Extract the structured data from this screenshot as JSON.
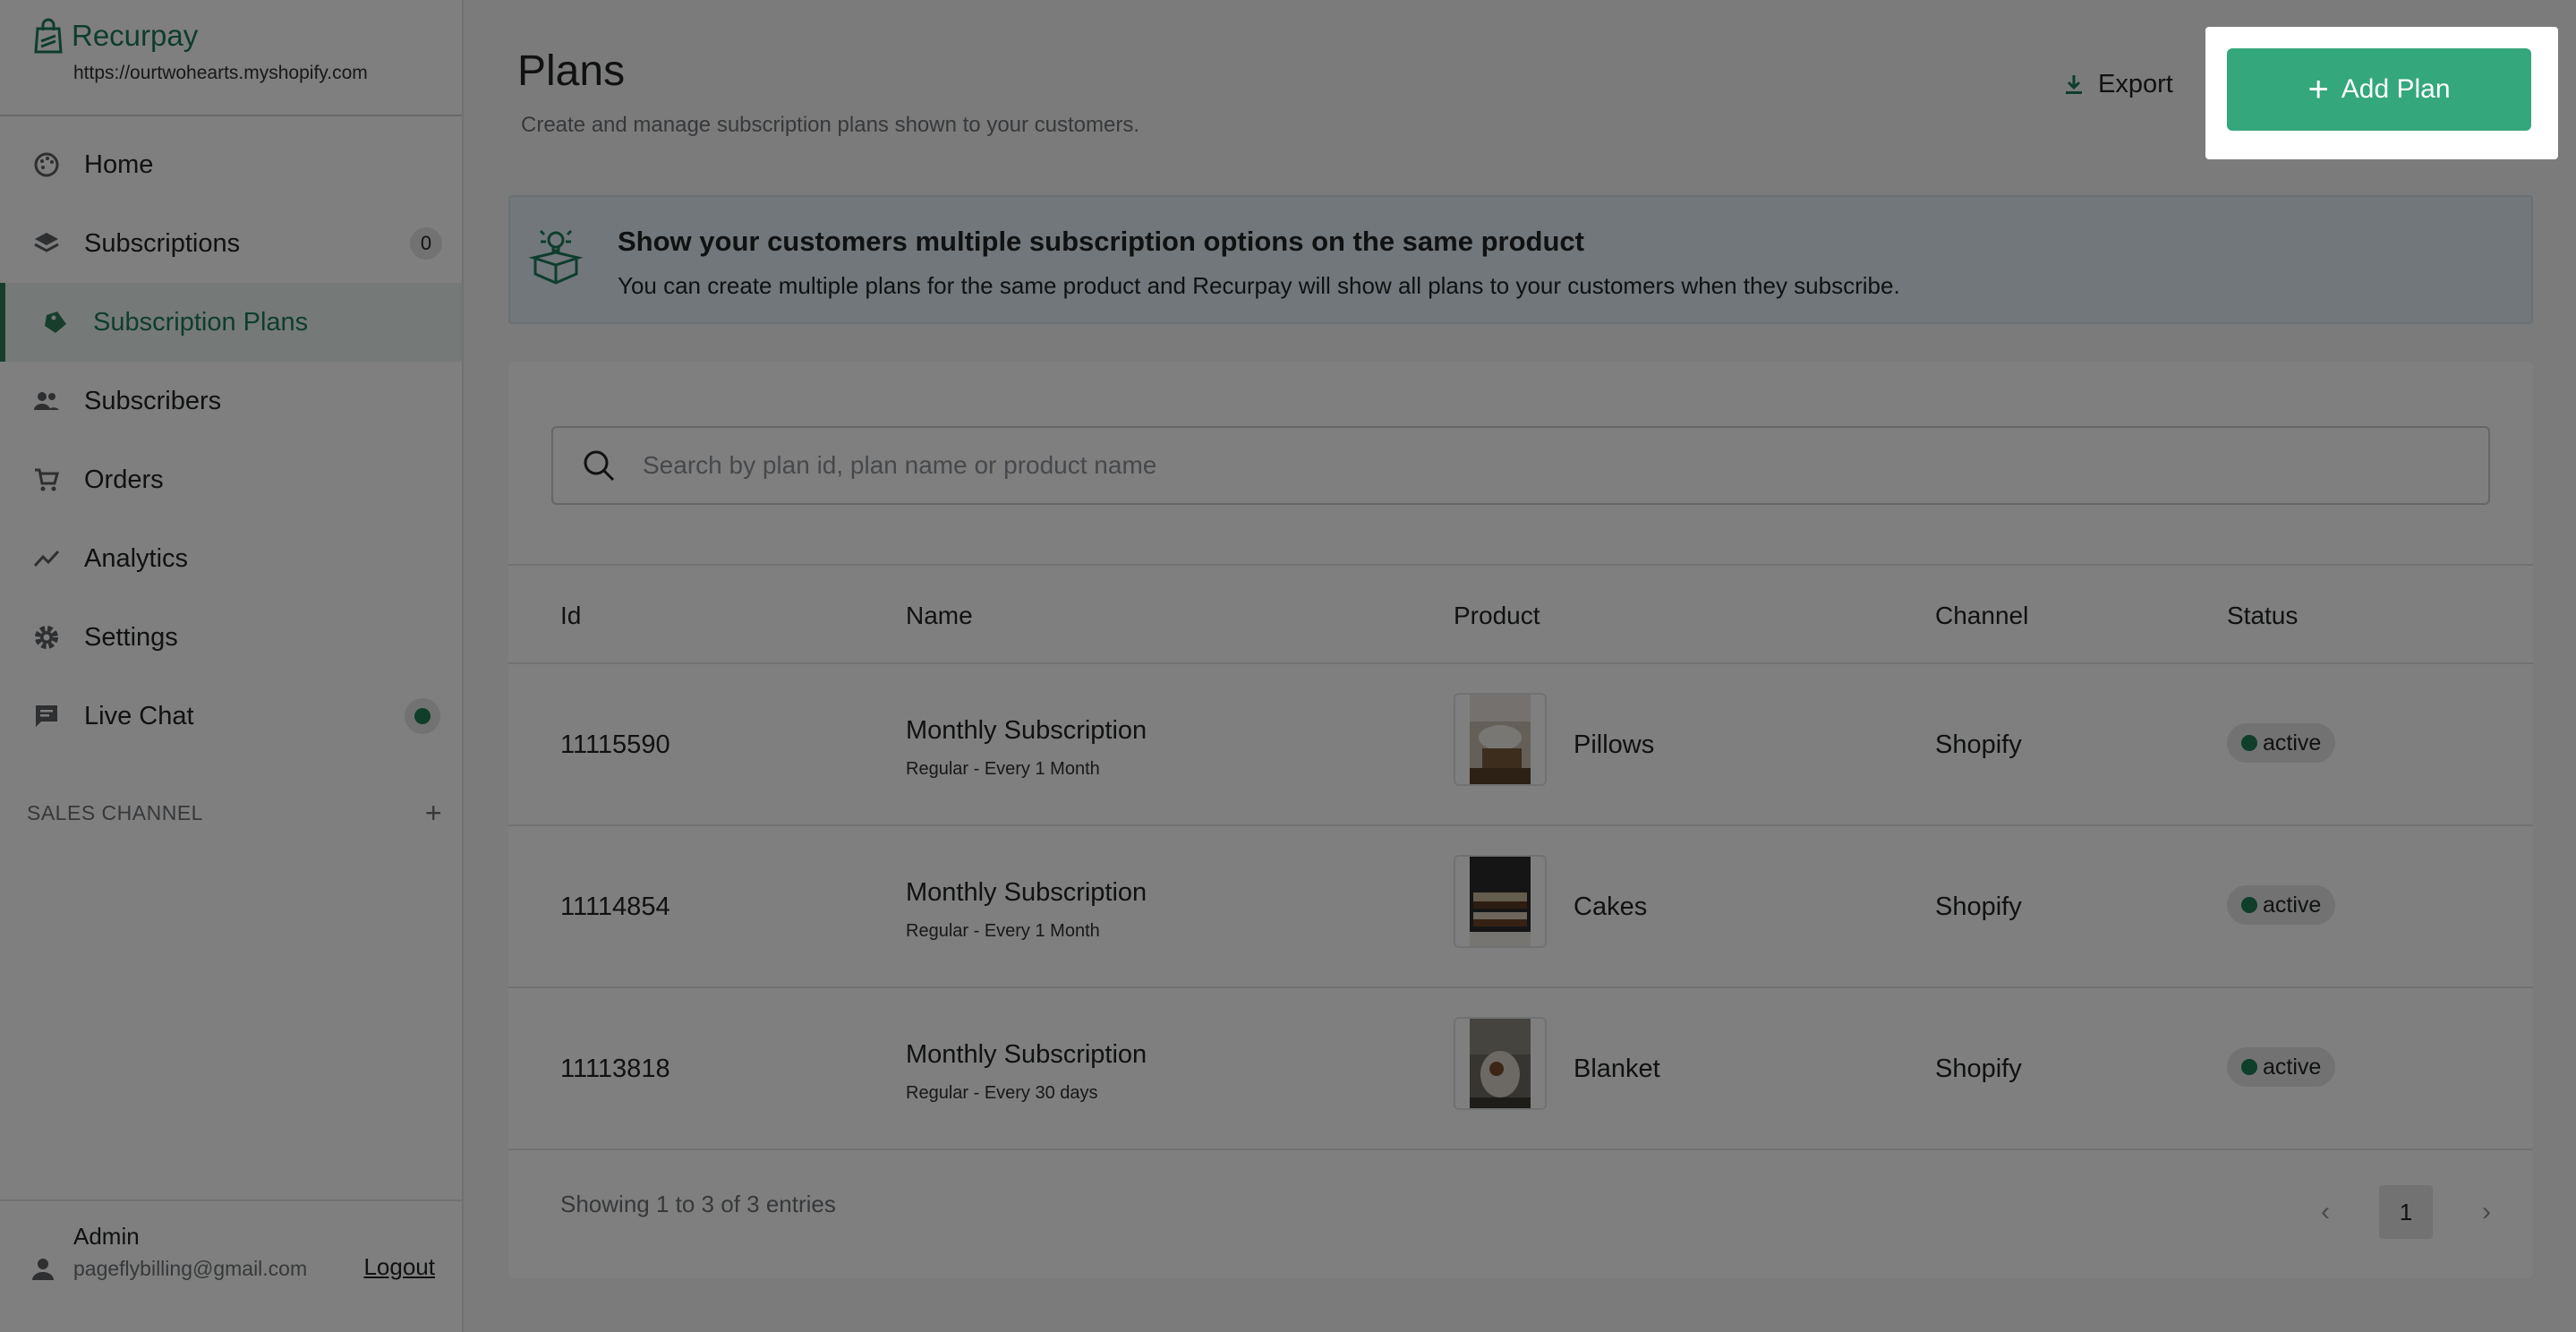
{
  "brand": {
    "name": "Recurpay",
    "store_url": "https://ourtwohearts.myshopify.com"
  },
  "sidebar": {
    "items": [
      {
        "label": "Home",
        "icon": "palette-icon"
      },
      {
        "label": "Subscriptions",
        "icon": "layers-icon",
        "badge": "0"
      },
      {
        "label": "Subscription Plans",
        "icon": "tag-icon",
        "active": true
      },
      {
        "label": "Subscribers",
        "icon": "people-icon"
      },
      {
        "label": "Orders",
        "icon": "cart-icon"
      },
      {
        "label": "Analytics",
        "icon": "trend-icon"
      },
      {
        "label": "Settings",
        "icon": "gear-icon"
      },
      {
        "label": "Live Chat",
        "icon": "chat-icon"
      }
    ],
    "sales_channel_label": "SALES CHANNEL",
    "admin": {
      "name": "Admin",
      "email": "pageflybilling@gmail.com",
      "logout_label": "Logout"
    }
  },
  "header": {
    "title": "Plans",
    "subtitle": "Create and manage subscription plans shown to your customers.",
    "export_label": "Export",
    "add_plan_label": "Add Plan"
  },
  "banner": {
    "title": "Show your customers multiple subscription options on the same product",
    "text": "You can create multiple plans for the same product and Recurpay will show all plans to your customers when they subscribe."
  },
  "search": {
    "placeholder": "Search by plan id, plan name or product name"
  },
  "table": {
    "columns": [
      "Id",
      "Name",
      "Product",
      "Channel",
      "Status"
    ],
    "rows": [
      {
        "id": "11115590",
        "name": "Monthly Subscription",
        "frequency": "Regular - Every 1 Month",
        "product": "Pillows",
        "channel": "Shopify",
        "status": "active"
      },
      {
        "id": "11114854",
        "name": "Monthly Subscription",
        "frequency": "Regular - Every 1 Month",
        "product": "Cakes",
        "channel": "Shopify",
        "status": "active"
      },
      {
        "id": "11113818",
        "name": "Monthly Subscription",
        "frequency": "Regular - Every 30 days",
        "product": "Blanket",
        "channel": "Shopify",
        "status": "active"
      }
    ],
    "footer": "Showing 1 to 3 of 3 entries",
    "current_page": "1"
  },
  "colors": {
    "accent": "#34a77d",
    "brand": "#1f7a5a",
    "status_active": "#1e7c56"
  }
}
